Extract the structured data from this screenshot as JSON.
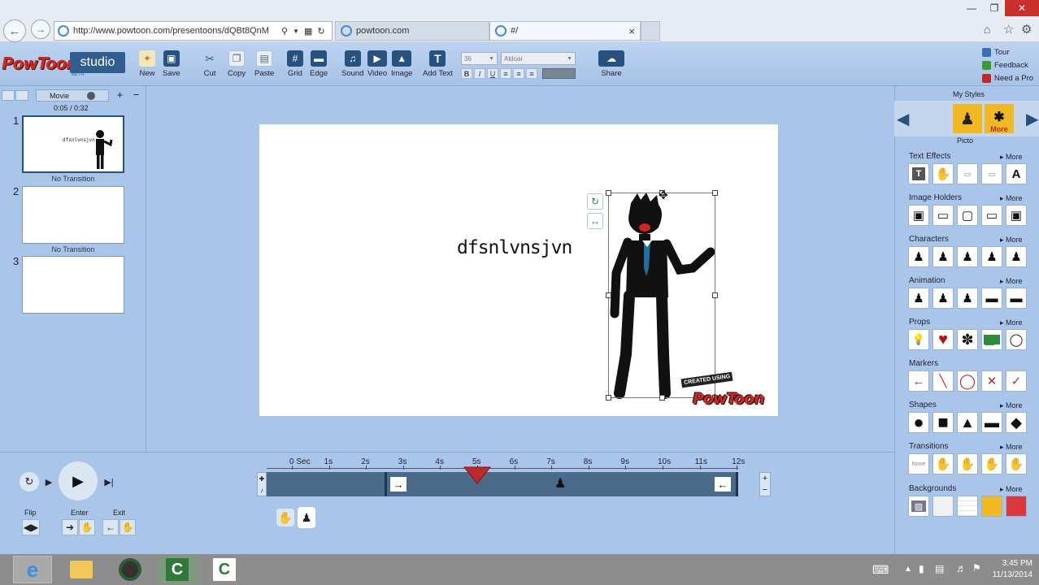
{
  "browser": {
    "url": "http://www.powtoon.com/presentoons/dQBt8QnM",
    "tabs": [
      {
        "label": "powtoon.com",
        "active": false
      },
      {
        "label": "#/",
        "active": true
      }
    ],
    "tab_close": "×"
  },
  "toolbar": {
    "logo_text": "PowToon",
    "studio_label": "studio",
    "beta_label": "BETA",
    "buttons": [
      {
        "label": "New",
        "icon": "new-document-icon"
      },
      {
        "label": "Save",
        "icon": "save-icon"
      },
      {
        "label": "Cut",
        "icon": "scissors-icon"
      },
      {
        "label": "Copy",
        "icon": "copy-icon"
      },
      {
        "label": "Paste",
        "icon": "paste-icon"
      },
      {
        "label": "Grid",
        "icon": "grid-icon"
      },
      {
        "label": "Edge",
        "icon": "edge-icon"
      },
      {
        "label": "Sound",
        "icon": "music-note-icon"
      },
      {
        "label": "Video",
        "icon": "video-icon"
      },
      {
        "label": "Image",
        "icon": "image-icon"
      },
      {
        "label": "Add Text",
        "icon": "text-T-icon"
      },
      {
        "label": "Share",
        "icon": "cloud-upload-icon"
      }
    ],
    "font_size": "36",
    "font_name": "Aldoar",
    "format_buttons": [
      "B",
      "I",
      "U"
    ]
  },
  "help": [
    {
      "label": "Tour",
      "color": "#3a6fb0"
    },
    {
      "label": "Feedback",
      "color": "#3a9a3a"
    },
    {
      "label": "Need a Pro",
      "color": "#c0282a"
    }
  ],
  "left_panel": {
    "mode_label": "Movie",
    "time": "0:05 / 0:32",
    "slides": [
      {
        "number": "1",
        "transition": "No Transition",
        "thumb_text": "dfsnlvnsjvn"
      },
      {
        "number": "2",
        "transition": "No Transition",
        "thumb_text": ""
      },
      {
        "number": "3",
        "transition": "",
        "thumb_text": ""
      }
    ]
  },
  "canvas": {
    "text": "dfsnlvnsjvn",
    "watermark_top": "CREATED USING",
    "watermark_brand": "PowToon"
  },
  "right_panel": {
    "my_styles": "My Styles",
    "style_name": "Picto",
    "style_more": "More",
    "more_label": "▸ More",
    "sections": [
      {
        "title": "Text Effects",
        "items": [
          "T",
          "✋",
          "▭",
          "▭",
          "A"
        ]
      },
      {
        "title": "Image Holders",
        "items": [
          "▣",
          "▭",
          "▢",
          "▭",
          "▣"
        ]
      },
      {
        "title": "Characters",
        "items": [
          "♟",
          "♟",
          "♟",
          "♟",
          "♟"
        ]
      },
      {
        "title": "Animation",
        "items": [
          "♟",
          "♟",
          "♟",
          "▬",
          "▬"
        ]
      },
      {
        "title": "Props",
        "items": [
          "💡",
          "♥",
          "✽",
          "▭",
          "◯"
        ]
      },
      {
        "title": "Markers",
        "items": [
          "←",
          "╲",
          "◯",
          "✕",
          "✓"
        ]
      },
      {
        "title": "Shapes",
        "items": [
          "●",
          "■",
          "▲",
          "▬",
          "◆"
        ]
      },
      {
        "title": "Transitions",
        "items": [
          "None",
          "✋",
          "✋",
          "✋",
          "✋"
        ]
      },
      {
        "title": "Backgrounds",
        "items": [
          "▨",
          "",
          "",
          "",
          ""
        ]
      }
    ],
    "background_colors": [
      "#ffffff",
      "#f2f2f2",
      "#ffffff",
      "#f0b921",
      "#d9383c"
    ],
    "props_colors": {
      "heart": "#b3141c",
      "money": "#2f8a3a"
    }
  },
  "timeline": {
    "ticks": [
      "0 Sec",
      "1s",
      "2s",
      "3s",
      "4s",
      "5s",
      "6s",
      "7s",
      "8s",
      "9s",
      "10s",
      "11s",
      "12s"
    ],
    "playhead_seconds": 5,
    "enter_seconds": 2.5,
    "exit_seconds": 12,
    "labels": {
      "flip": "Flip",
      "enter": "Enter",
      "exit": "Exit"
    },
    "zoom_in": "+",
    "zoom_out": "−"
  },
  "taskbar": {
    "time": "3:45 PM",
    "date": "11/13/2014"
  },
  "colors": {
    "accent_red": "#d9251c",
    "playhead": "#c0282a",
    "toolbar_blue": "#27527f"
  }
}
